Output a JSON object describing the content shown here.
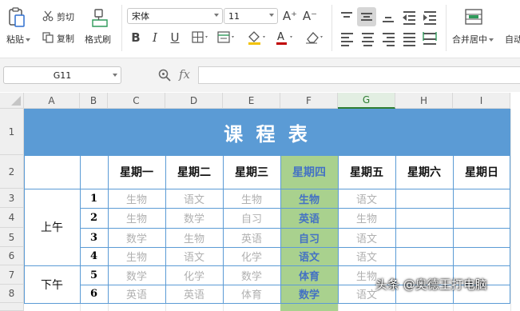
{
  "ribbon": {
    "paste_label": "粘贴",
    "cut_label": "剪切",
    "copy_label": "复制",
    "format_painter_label": "格式刷",
    "font_name": "宋体",
    "font_size": "11",
    "grow_font_glyph": "A⁺",
    "shrink_font_glyph": "A⁻",
    "bold": "B",
    "italic": "I",
    "underline": "U",
    "font_color_glyph": "A",
    "merge_center_label": "合并居中",
    "wrap_label_partial": "自动"
  },
  "formula_bar": {
    "name_box": "G11",
    "fx": "fx",
    "formula": ""
  },
  "columns": [
    "A",
    "B",
    "C",
    "D",
    "E",
    "F",
    "G",
    "H",
    "I"
  ],
  "selected_column": "G",
  "rows": [
    "1",
    "2",
    "3",
    "4",
    "5",
    "6",
    "7",
    "8"
  ],
  "table": {
    "title": "课 程 表",
    "weekdays": [
      "星期一",
      "星期二",
      "星期三",
      "星期四",
      "星期五",
      "星期六",
      "星期日"
    ],
    "morning_label": "上午",
    "afternoon_label": "下午",
    "periods": [
      "1",
      "2",
      "3",
      "4",
      "5",
      "6"
    ],
    "schedule": [
      [
        "生物",
        "语文",
        "生物",
        "生物",
        "语文"
      ],
      [
        "生物",
        "数学",
        "自习",
        "英语",
        "生物"
      ],
      [
        "数学",
        "生物",
        "英语",
        "自习",
        "语文"
      ],
      [
        "生物",
        "语文",
        "化学",
        "语文",
        "语文"
      ],
      [
        "数学",
        "化学",
        "数学",
        "体育",
        "生物"
      ],
      [
        "英语",
        "英语",
        "体育",
        "数学",
        "语文"
      ]
    ]
  },
  "watermark": "头条 @奥德王打电脑",
  "colors": {
    "title_bg": "#5b9bd5",
    "thursday_bg": "#a9d18e",
    "thursday_text": "#4472c4",
    "grid_line": "#5b9bd5",
    "selected_header": "#2e7d32"
  }
}
